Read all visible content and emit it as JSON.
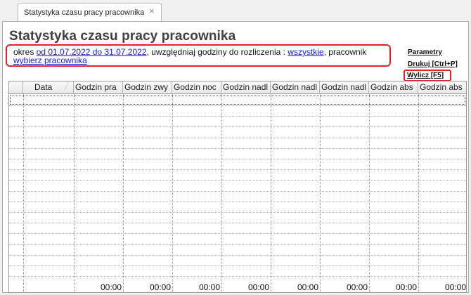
{
  "tab": {
    "title": "Statystyka czasu pracy pracownika",
    "close": "×"
  },
  "page": {
    "title": "Statystyka czasu pracy pracownika"
  },
  "filters": {
    "prefix": "okres ",
    "period": "od 01.07.2022 do 31.07.2022",
    "mid": ", uwzględniaj godziny do rozliczenia : ",
    "hours_mode": "wszystkie",
    "mid2": ", pracownik ",
    "employee": "wybierz pracownika"
  },
  "actions": {
    "params": "Parametry",
    "print": "Drukuj [Ctrl+P]",
    "calc": "Wylicz [F5]"
  },
  "grid": {
    "columns": [
      "Data",
      "Godzin pra",
      "Godzin zwy",
      "Godzin noc",
      "Godzin nadl",
      "Godzin nadl",
      "Godzin nadl",
      "Godzin abs",
      "Godzin abs"
    ],
    "footer": [
      "00:00",
      "00:00",
      "00:00",
      "00:00",
      "00:00",
      "00:00",
      "00:00",
      "00:00"
    ]
  },
  "colors": {
    "highlight": "#e4202a",
    "link": "#1a1ae0"
  }
}
